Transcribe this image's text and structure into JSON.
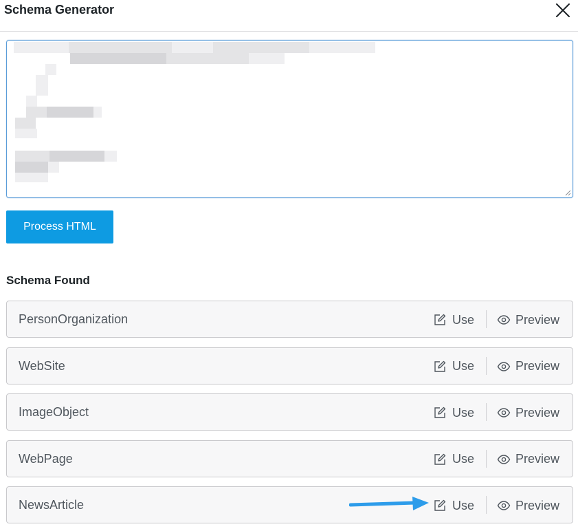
{
  "modal": {
    "title": "Schema Generator"
  },
  "editor": {
    "placeholder": ""
  },
  "actions": {
    "process_label": "Process HTML"
  },
  "results": {
    "heading": "Schema Found",
    "use_label": "Use",
    "preview_label": "Preview",
    "items": [
      {
        "name": "PersonOrganization"
      },
      {
        "name": "WebSite"
      },
      {
        "name": "ImageObject"
      },
      {
        "name": "WebPage"
      },
      {
        "name": "NewsArticle"
      }
    ]
  },
  "colors": {
    "primary_button": "#0e9be2",
    "textarea_focus_border": "#5b9dd9",
    "annotation_arrow": "#2d9cea"
  },
  "icons": {
    "close": "close-icon",
    "use": "edit-icon",
    "preview": "eye-icon"
  }
}
